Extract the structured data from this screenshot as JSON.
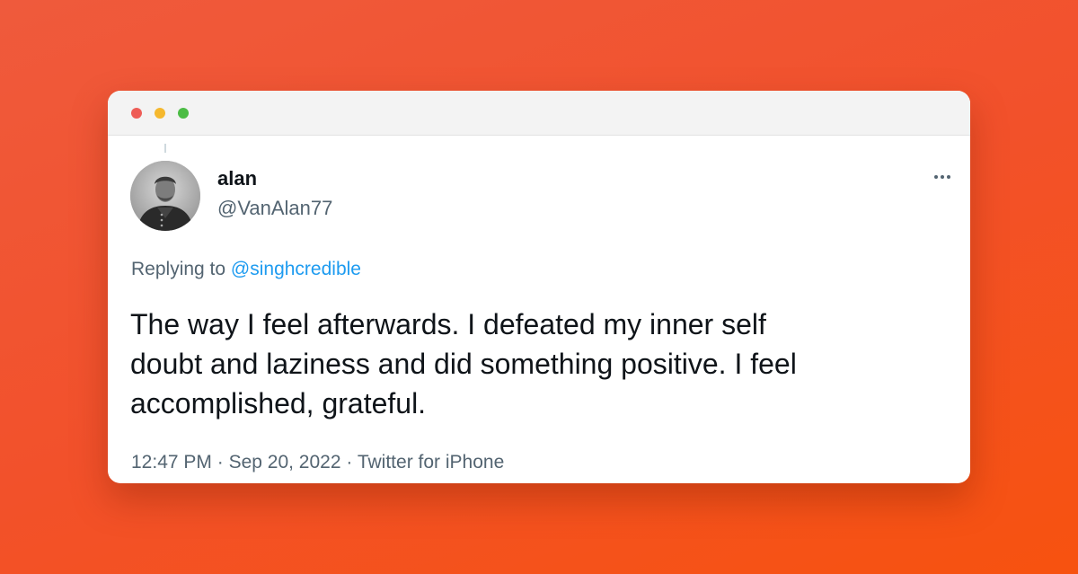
{
  "window": {
    "controls": [
      "close",
      "minimize",
      "maximize"
    ]
  },
  "tweet": {
    "display_name": "alan",
    "handle": "@VanAlan77",
    "avatar_icon": "avatar-portrait-icon",
    "more_icon": "more-options-icon",
    "replying_prefix": "Replying to",
    "replying_to": "@singhcredible",
    "text": "The way I feel afterwards. I defeated my inner self\ndoubt and laziness and did something positive. I feel\naccomplished, grateful.",
    "time": "12:47 PM",
    "separator": "·",
    "date": "Sep 20, 2022",
    "source": "Twitter for iPhone"
  },
  "colors": {
    "background_start": "#ef5a3c",
    "background_end": "#f7520f",
    "link": "#1d9bf0",
    "secondary_text": "#536471",
    "primary_text": "#0f1419"
  }
}
